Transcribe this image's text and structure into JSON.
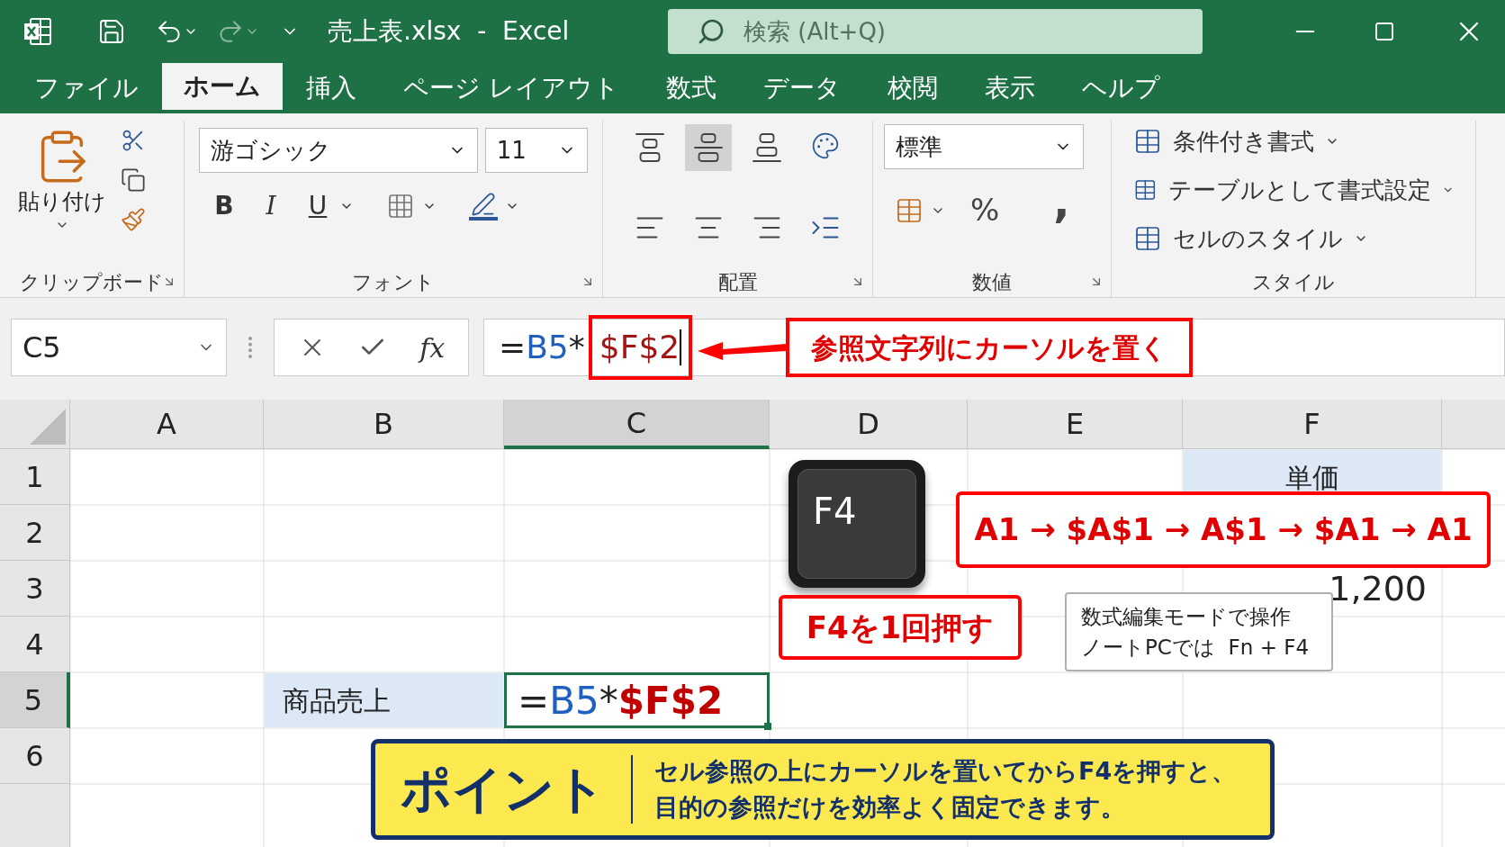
{
  "title_bar": {
    "filename": "売上表.xlsx  -  Excel",
    "search_placeholder": "検索 (Alt+Q)"
  },
  "ribbon_tabs": [
    {
      "label": "ファイル",
      "selected": false
    },
    {
      "label": "ホーム",
      "selected": true
    },
    {
      "label": "挿入",
      "selected": false
    },
    {
      "label": "ページ レイアウト",
      "selected": false
    },
    {
      "label": "数式",
      "selected": false
    },
    {
      "label": "データ",
      "selected": false
    },
    {
      "label": "校閲",
      "selected": false
    },
    {
      "label": "表示",
      "selected": false
    },
    {
      "label": "ヘルプ",
      "selected": false
    }
  ],
  "ribbon": {
    "clipboard": {
      "label": "クリップボード",
      "paste": "貼り付け"
    },
    "font": {
      "label": "フォント",
      "font_name": "游ゴシック",
      "font_size": "11",
      "bold": "B",
      "italic": "I",
      "underline": "U"
    },
    "alignment": {
      "label": "配置"
    },
    "number": {
      "label": "数値",
      "format": "標準",
      "percent": "%",
      "comma": ","
    },
    "styles": {
      "label": "スタイル",
      "items": [
        "条件付き書式",
        "テーブルとして書式設定",
        "セルのスタイル"
      ]
    }
  },
  "formula_bar": {
    "name_box": "C5",
    "fx": "fx",
    "parts": [
      {
        "text": "=",
        "color": "#222222"
      },
      {
        "text": "B5",
        "color": "#1f5fbf"
      },
      {
        "text": "*",
        "color": "#222222"
      }
    ],
    "boxed_parts": [
      {
        "text": "$F$",
        "color": "#a31515"
      },
      {
        "text": "2",
        "color": "#a31515"
      }
    ]
  },
  "columns": [
    {
      "label": "A",
      "selected": false
    },
    {
      "label": "B",
      "selected": false
    },
    {
      "label": "C",
      "selected": true
    },
    {
      "label": "D",
      "selected": false
    },
    {
      "label": "E",
      "selected": false
    },
    {
      "label": "F",
      "selected": false
    }
  ],
  "rows": [
    {
      "header": "1",
      "selected": false,
      "cells": [
        {},
        {},
        {},
        {},
        {},
        {
          "kind": "heading",
          "text": "単価",
          "highlighted": true
        }
      ]
    },
    {
      "header": "2",
      "selected": false,
      "cells": [
        {},
        {},
        {},
        {},
        {},
        {}
      ]
    },
    {
      "header": "3",
      "selected": false,
      "cells": [
        {},
        {},
        {},
        {},
        {},
        {
          "kind": "number",
          "text": "1,200",
          "highlighted": false
        }
      ]
    },
    {
      "header": "4",
      "selected": false,
      "cells": [
        {},
        {},
        {},
        {},
        {},
        {}
      ]
    },
    {
      "header": "5",
      "selected": true,
      "cells": [
        {},
        {
          "kind": "text",
          "text": "商品売上",
          "highlighted": true
        },
        {
          "active": true,
          "parts": [
            {
              "text": "=",
              "color": "#222222"
            },
            {
              "text": "B5",
              "color": "#1f5fbf"
            },
            {
              "text": "*",
              "color": "#222222"
            },
            {
              "text": "$F$2",
              "color": "#c00000"
            }
          ]
        },
        {},
        {},
        {}
      ]
    },
    {
      "header": "6",
      "selected": false,
      "cells": [
        {},
        {},
        {},
        {},
        {},
        {}
      ]
    }
  ],
  "formula_callout": "参照文字列にカーソルを置く",
  "f4_key": "F4",
  "cycle_callout": "A1 → $A$1 → A$1 → $A1 → A1",
  "press_callout": "F4を1回押す",
  "tip_note": [
    "数式編集モードで操作",
    "ノートPCでは  Fn + F4"
  ],
  "point_banner": {
    "title": "ポイント",
    "lines": [
      "セル参照の上にカーソルを置いてからF4を押すと、",
      "目的の参照だけを効率よく固定できます。"
    ]
  }
}
